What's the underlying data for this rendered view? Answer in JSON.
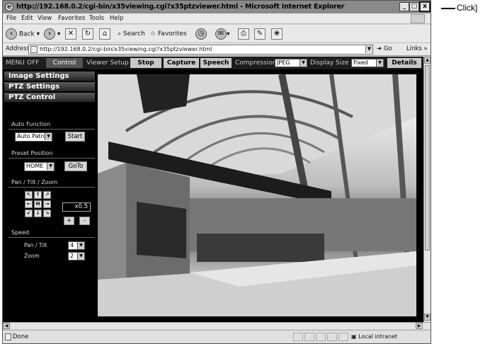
{
  "browser": {
    "title": "http://192.168.0.2/cgi-bin/x35viewing.cgi?x35ptzviewer.html - Microsoft Internet Explorer",
    "window_buttons": {
      "minimize": "_",
      "restore": "□",
      "close": "x"
    },
    "menu": [
      "File",
      "Edit",
      "View",
      "Favorites",
      "Tools",
      "Help"
    ],
    "toolbar": {
      "back": "Back",
      "search": "Search",
      "favorites": "Favorites"
    },
    "address": {
      "label": "Address",
      "url": "http://192.168.0.2/cgi-bin/x35viewing.cgi?x35ptzviewer.html",
      "go": "Go",
      "links": "Links »"
    },
    "status": {
      "text": "Done",
      "zone": "Local intranet"
    }
  },
  "viewer": {
    "topnav": {
      "menu": "MENU",
      "off": "OFF",
      "control": "Control",
      "viewer_setup": "Viewer Setup",
      "stop": "Stop",
      "capture": "Capture",
      "speech": "Speech",
      "compression_label": "Compression",
      "compression_value": "JPEG",
      "display_size_label": "Display Size",
      "display_size_value": "Fixed",
      "details": "Details"
    },
    "sidebar": {
      "image_settings": "Image Settings",
      "ptz_settings": "PTZ Settings",
      "ptz_control": "PTZ Control",
      "auto_function": {
        "label": "Auto Function",
        "value": "Auto Patrol",
        "button": "Start"
      },
      "preset_position": {
        "label": "Preset Position",
        "value": "HOME",
        "button": "GoTo"
      },
      "pan_tilt_zoom": {
        "label": "Pan / Tilt / Zoom",
        "zoom_value": "x0.5",
        "zoom_in": "+",
        "zoom_out": "-",
        "grid": [
          [
            "↖",
            "↑",
            "↗"
          ],
          [
            "←",
            "H",
            "→"
          ],
          [
            "↙",
            "↓",
            "↘"
          ]
        ]
      },
      "speed": {
        "label": "Speed",
        "pan_tilt_label": "Pan / Tilt",
        "pan_tilt_value": "4",
        "zoom_label": "Zoom",
        "zoom_value": "2"
      }
    }
  },
  "annotation": {
    "text": "Click]"
  }
}
